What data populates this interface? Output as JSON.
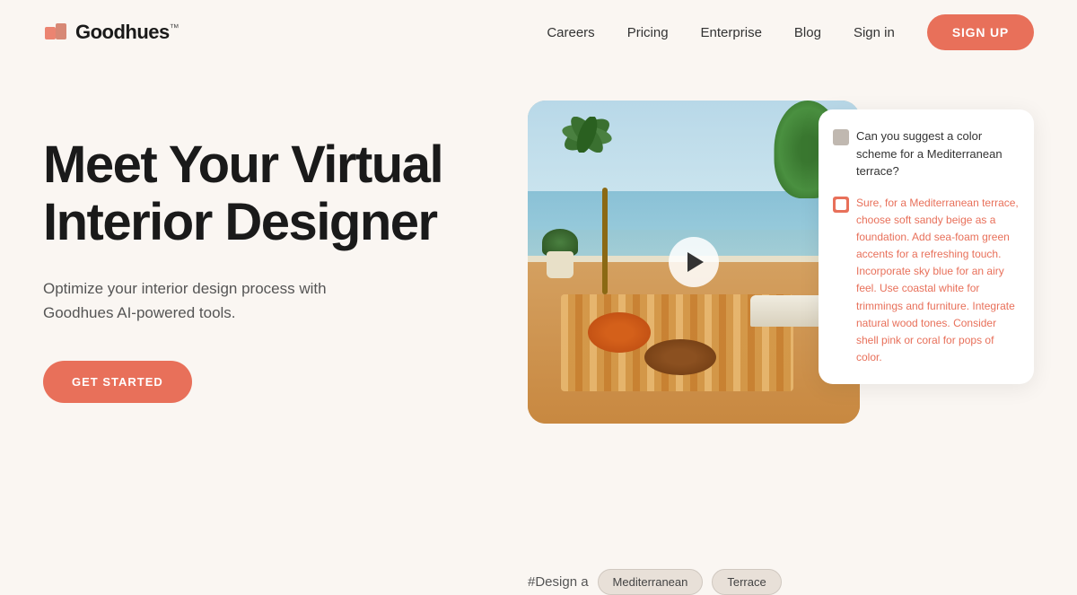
{
  "brand": {
    "name": "Goodhues",
    "trademark": "™",
    "logo_icon_color": "#e8705a"
  },
  "nav": {
    "links": [
      {
        "id": "careers",
        "label": "Careers"
      },
      {
        "id": "pricing",
        "label": "Pricing"
      },
      {
        "id": "enterprise",
        "label": "Enterprise"
      },
      {
        "id": "blog",
        "label": "Blog"
      },
      {
        "id": "signin",
        "label": "Sign in"
      }
    ],
    "cta_label": "SIGN UP"
  },
  "hero": {
    "title_line1": "Meet Your Virtual",
    "title_line2": "Interior Designer",
    "subtitle": "Optimize your interior design process with Goodhues AI-powered tools.",
    "cta_label": "GET STARTED"
  },
  "image_section": {
    "hashtag": "#Design a",
    "tags": [
      "Mediterranean",
      "Terrace"
    ]
  },
  "chat": {
    "question": "Can you suggest a color scheme for a Mediterranean terrace?",
    "answer": "Sure, for a Mediterranean terrace, choose soft sandy beige as a foundation. Add sea-foam green accents for a refreshing touch. Incorporate sky blue for an airy feel. Use coastal white for trimmings and furniture. Integrate natural wood tones. Consider shell pink or coral for pops of color."
  },
  "colors": {
    "accent": "#e8705a",
    "background": "#faf6f2",
    "text_primary": "#1a1a1a",
    "text_secondary": "#555555"
  }
}
